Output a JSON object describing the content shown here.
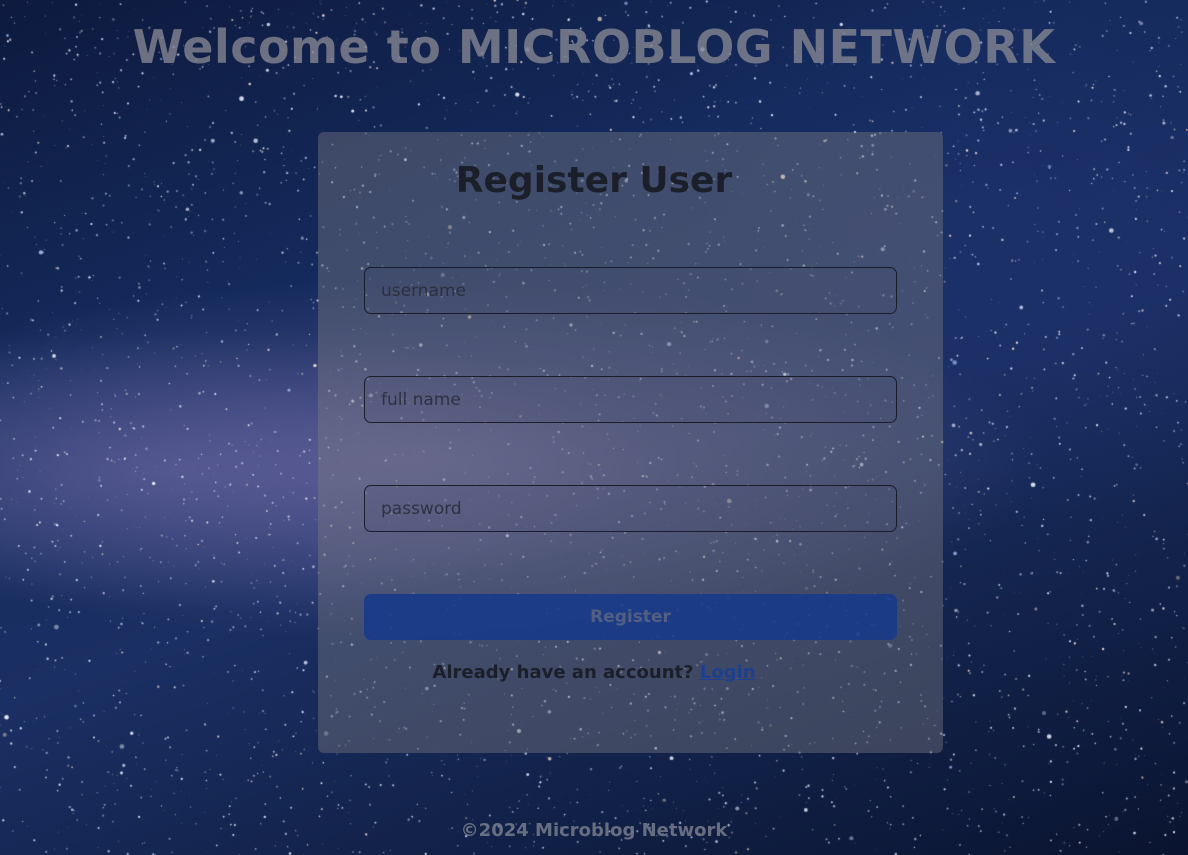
{
  "header": {
    "title": "Welcome to MICROBLOG NETWORK"
  },
  "form": {
    "title": "Register User",
    "username_placeholder": "username",
    "fullname_placeholder": "full name",
    "password_placeholder": "password",
    "submit_label": "Register",
    "login_prompt": "Already have an account?",
    "login_link": "Login"
  },
  "footer": {
    "text": "©2024 Microblog Network"
  },
  "colors": {
    "button": "#163a8c",
    "link": "#1d3f8f",
    "background": "#142a5c"
  }
}
